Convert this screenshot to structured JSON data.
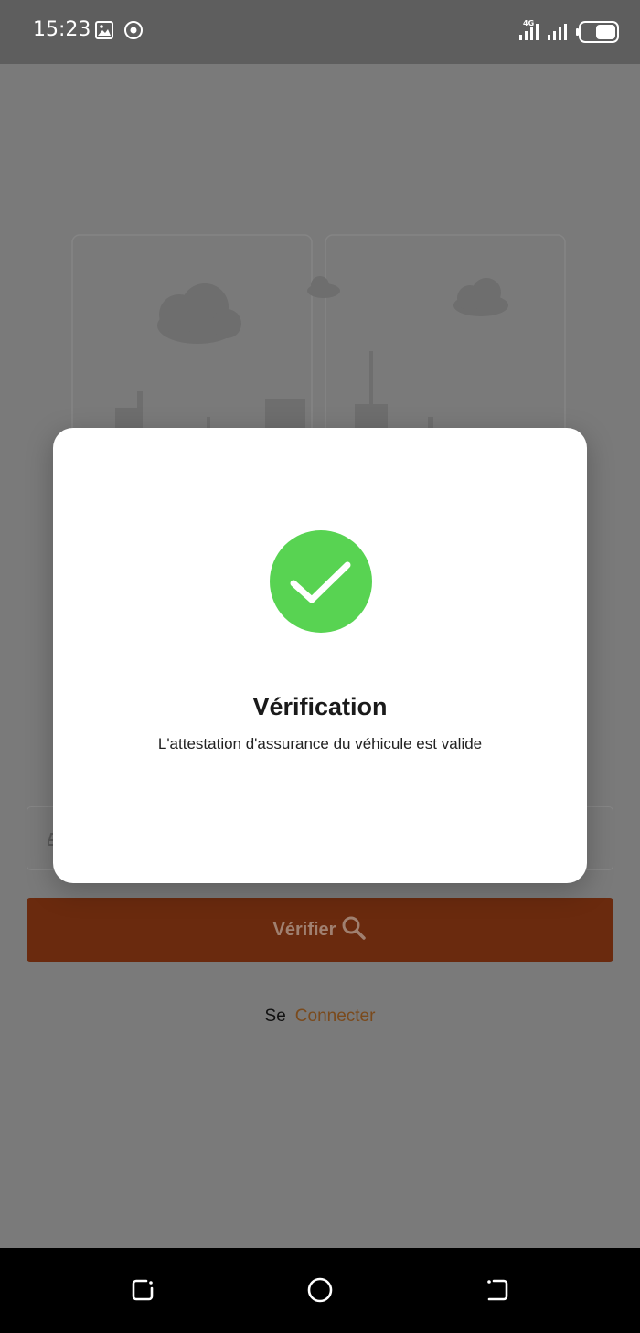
{
  "status_bar": {
    "time": "15:23",
    "icons": [
      "image-icon",
      "media-icon",
      "signal-4g-icon",
      "signal-icon",
      "battery-icon"
    ]
  },
  "form": {
    "verify_label": "Vérifier",
    "verify_icon": "search-icon",
    "input_icon": "car-icon"
  },
  "login": {
    "prefix": "Se",
    "link": "Connecter"
  },
  "modal": {
    "icon": "check-circle-icon",
    "title": "Vérification",
    "message": "L'attestation d'assurance du véhicule est valide"
  },
  "nav": {
    "icons": [
      "recent-apps-icon",
      "home-icon",
      "back-icon"
    ]
  },
  "colors": {
    "overlay_bg": "#7a7a7a",
    "accent": "#6a2a0e",
    "success": "#58d352",
    "link": "#7a4a1c"
  }
}
